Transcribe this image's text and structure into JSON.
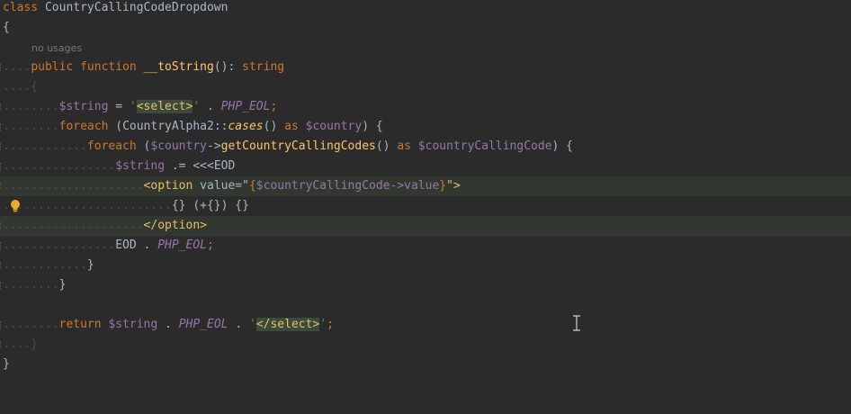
{
  "editor": {
    "usage_hint": "no usages",
    "lines": {
      "l1_kw": "class",
      "l1_name": " CountryCallingCodeDropdown",
      "l2": "{",
      "l4_guide": "....",
      "l4_kw1": "public",
      "l4_kw2": " function",
      "l4_fn": " __toString",
      "l4_paren": "():",
      "l4_type": " string",
      "l5": "....{",
      "l6_guide": "........",
      "l6_var": "$string",
      "l6_eq": " = ",
      "l6_q1": "'",
      "l6_tag": "<select>",
      "l6_q2": "'",
      "l6_dot": " . ",
      "l6_const": "PHP_EOL",
      "l6_semi": ";",
      "l7_guide": "........",
      "l7_kw": "foreach",
      "l7_p1": " (CountryAlpha2::",
      "l7_static": "cases",
      "l7_p2": "() ",
      "l7_as": "as",
      "l7_var": " $country",
      "l7_p3": ") {",
      "l8_guide": "............",
      "l8_kw": "foreach",
      "l8_p1": " (",
      "l8_var": "$country",
      "l8_arrow": "->",
      "l8_fn": "getCountryCallingCodes",
      "l8_p2": "() ",
      "l8_as": "as",
      "l8_var2": " $countryCallingCode",
      "l8_p3": ") {",
      "l9_guide": "................",
      "l9_var": "$string",
      "l9_op": " .= <<<EOD",
      "l10_guide": "....................",
      "l10_tag": "<option",
      "l10_attr": " value=\"",
      "l10_b1": "{",
      "l10_var": "$countryCallingCode->value",
      "l10_b2": "}",
      "l10_end": "\">",
      "l11_guide": "........................",
      "l11_text": "{} (+{}) {}",
      "l12_guide": "....................",
      "l12_tag": "</option>",
      "l13_guide": "................",
      "l13_eod": "EOD . ",
      "l13_const": "PHP_EOL",
      "l13_semi": ";",
      "l14_guide": "............",
      "l14": "}",
      "l15_guide": "........",
      "l15": "}",
      "l17_guide": "........",
      "l17_kw": "return",
      "l17_var": " $string",
      "l17_dot": " . ",
      "l17_const": "PHP_EOL",
      "l17_dot2": " . ",
      "l17_q1": "'",
      "l17_tag": "</select>",
      "l17_q2": "'",
      "l17_semi": ";",
      "l18": "....}",
      "l19": "}"
    }
  }
}
